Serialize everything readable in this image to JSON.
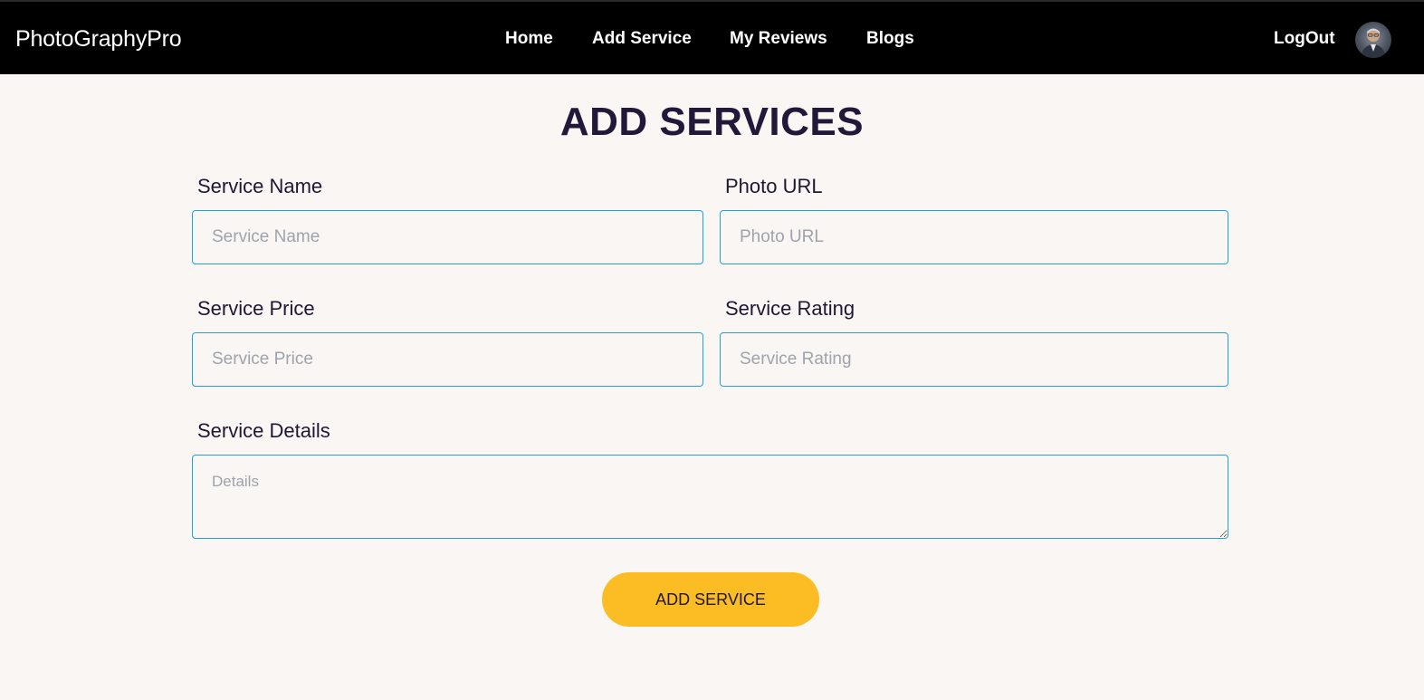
{
  "navbar": {
    "brand": "PhotoGraphyPro",
    "links": [
      "Home",
      "Add Service",
      "My Reviews",
      "Blogs"
    ],
    "logout": "LogOut",
    "avatar_icon": "user-avatar"
  },
  "main": {
    "title": "ADD SERVICES",
    "fields": {
      "service_name": {
        "label": "Service Name",
        "placeholder": "Service Name",
        "value": ""
      },
      "photo_url": {
        "label": "Photo URL",
        "placeholder": "Photo URL",
        "value": ""
      },
      "service_price": {
        "label": "Service Price",
        "placeholder": "Service Price",
        "value": ""
      },
      "service_rating": {
        "label": "Service Rating",
        "placeholder": "Service Rating",
        "value": ""
      },
      "service_details": {
        "label": "Service Details",
        "placeholder": "Details",
        "value": ""
      }
    },
    "submit_label": "ADD SERVICE"
  },
  "colors": {
    "navbar_bg": "#000000",
    "page_bg": "#faf6f3",
    "input_border": "#1ea3e0",
    "button_bg": "#fbbd23",
    "title_color": "#22183a"
  }
}
